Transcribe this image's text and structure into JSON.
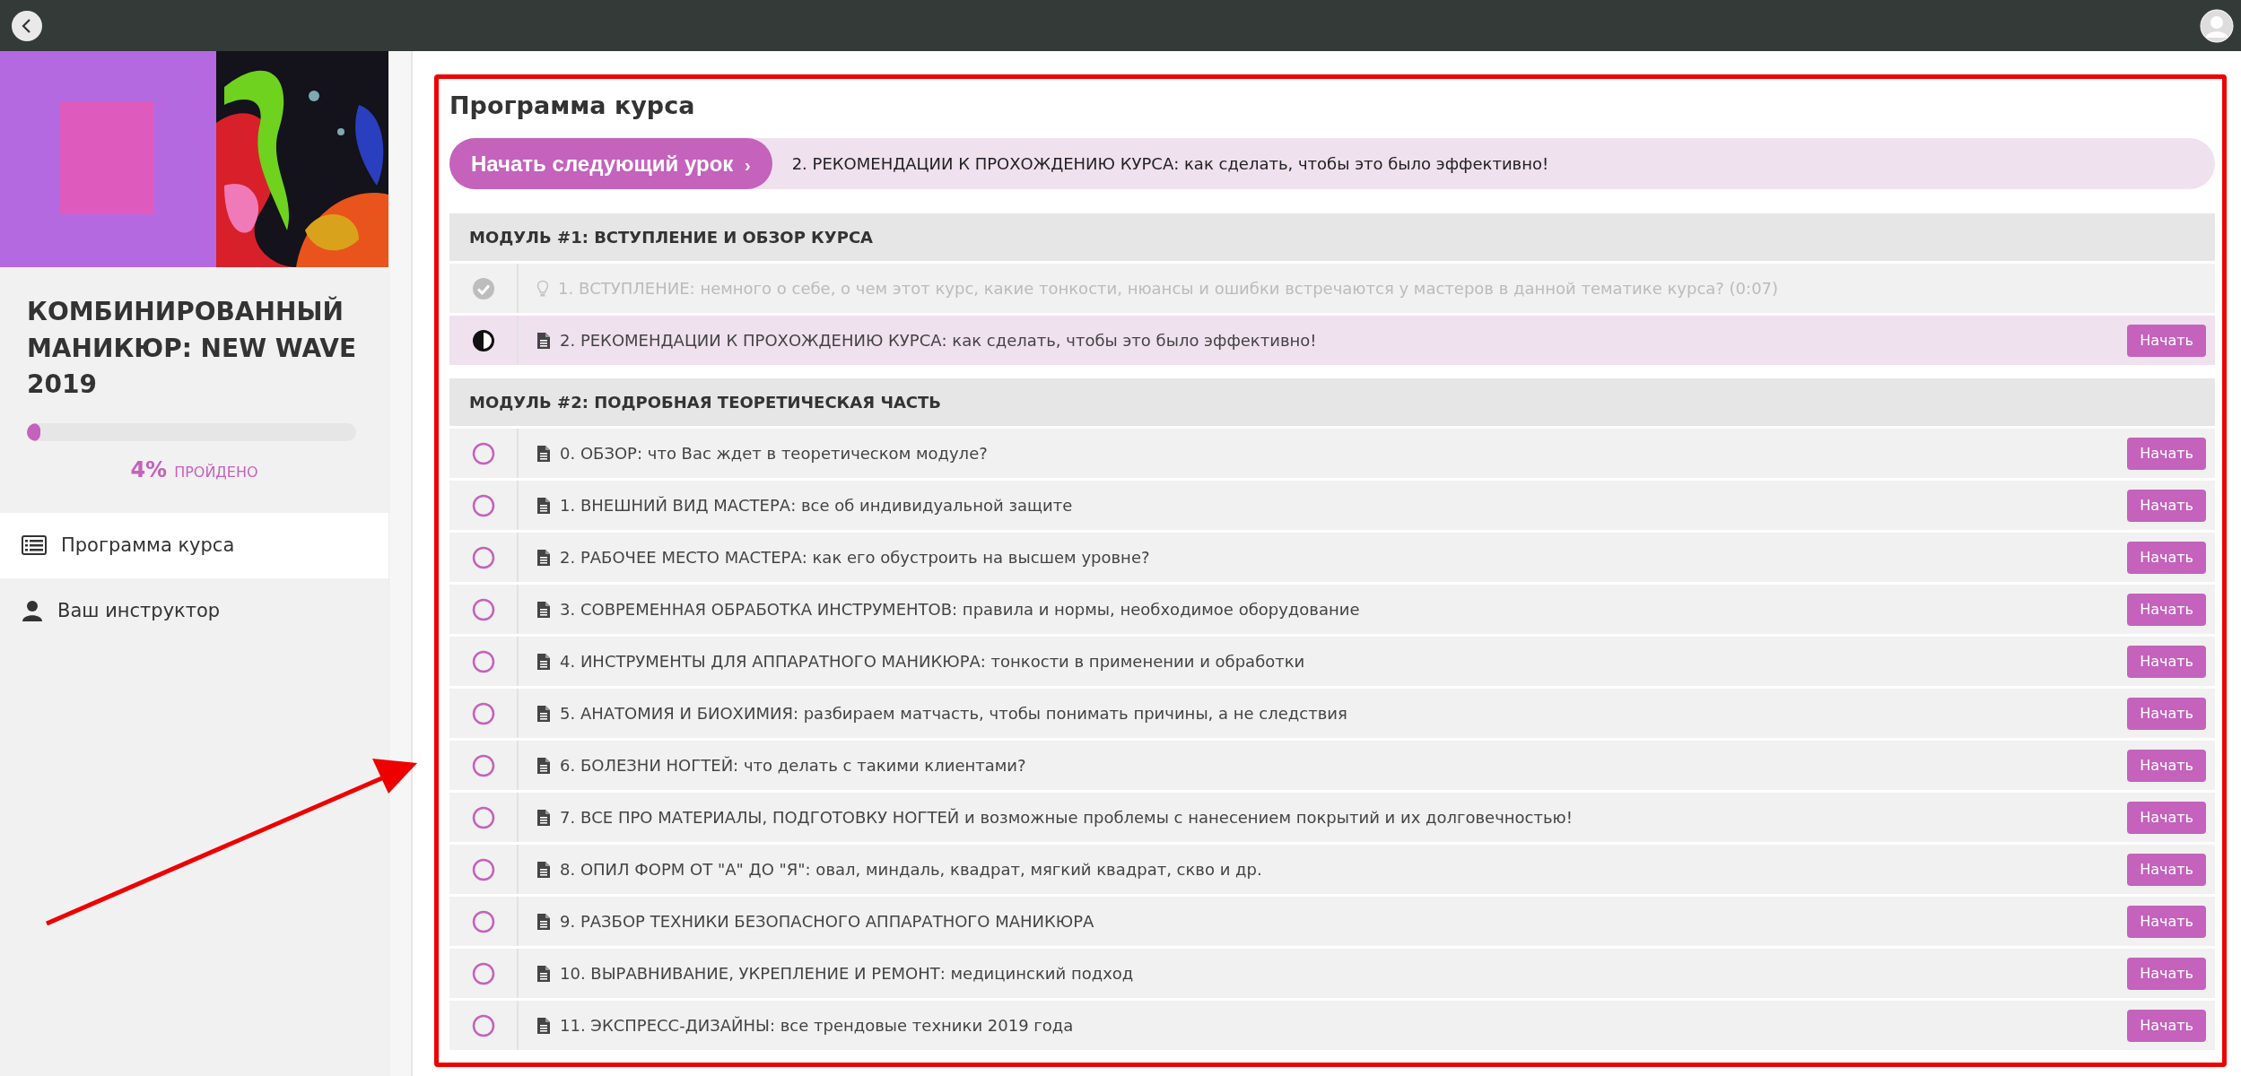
{
  "course": {
    "title": "КОМБИНИРОВАННЫЙ МАНИКЮР: NEW WAVE 2019",
    "progress": {
      "level": 0.04,
      "percent": "4%",
      "label": "ПРОЙДЕНО"
    }
  },
  "sidebar": {
    "items": [
      {
        "label": "Программа курса",
        "kind": "list",
        "selected": true
      },
      {
        "label": "Ваш инструктор",
        "kind": "person",
        "selected": false
      }
    ]
  },
  "main": {
    "title": "Программа курса",
    "next_lesson": {
      "button": "Начать следующий урок",
      "chevron": "›",
      "lesson": "2. РЕКОМЕНДАЦИИ К ПРОХОЖДЕНИЮ КУРСА: как сделать, чтобы это было эффективно!"
    },
    "modules": [
      {
        "title": "МОДУЛЬ #1: ВСТУПЛЕНИЕ И ОБЗОР КУРСА",
        "lessons": [
          {
            "done": true,
            "selected": false,
            "kind": "video",
            "title": "1. ВСТУПЛЕНИЕ: немного о себе, о чем этот курс, какие тонкости, нюансы и ошибки встречаются у мастеров в данной тематике курса? (0:07)"
          },
          {
            "done": false,
            "selected": true,
            "kind": "text",
            "title": "2. РЕКОМЕНДАЦИИ К ПРОХОЖДЕНИЮ КУРСА: как сделать, чтобы это было эффективно!",
            "button": "Начать"
          }
        ]
      },
      {
        "title": "МОДУЛЬ #2: ПОДРОБНАЯ ТЕОРЕТИЧЕСКАЯ ЧАСТЬ",
        "lessons": [
          {
            "done": false,
            "selected": false,
            "kind": "text",
            "title": "0. ОБЗОР: что Вас ждет в теоретическом модуле?",
            "button": "Начать"
          },
          {
            "done": false,
            "selected": false,
            "kind": "text",
            "title": "1. ВНЕШНИЙ ВИД МАСТЕРА: все об индивидуальной защите",
            "button": "Начать"
          },
          {
            "done": false,
            "selected": false,
            "kind": "text",
            "title": "2. РАБОЧЕЕ МЕСТО МАСТЕРА: как его обустроить на высшем уровне?",
            "button": "Начать"
          },
          {
            "done": false,
            "selected": false,
            "kind": "text",
            "title": "3. СОВРЕМЕННАЯ ОБРАБОТКА ИНСТРУМЕНТОВ: правила и нормы, необходимое оборудование",
            "button": "Начать"
          },
          {
            "done": false,
            "selected": false,
            "kind": "text",
            "title": "4. ИНСТРУМЕНТЫ ДЛЯ АППАРАТНОГО МАНИКЮРА: тонкости в применении и обработки",
            "button": "Начать"
          },
          {
            "done": false,
            "selected": false,
            "kind": "text",
            "title": "5. АНАТОМИЯ И БИОХИМИЯ: разбираем матчасть, чтобы понимать причины, а не следствия",
            "button": "Начать"
          },
          {
            "done": false,
            "selected": false,
            "kind": "text",
            "title": "6. БОЛЕЗНИ НОГТЕЙ: что делать с такими клиентами?",
            "button": "Начать"
          },
          {
            "done": false,
            "selected": false,
            "kind": "text",
            "title": "7. ВСЕ ПРО МАТЕРИАЛЫ, ПОДГОТОВКУ НОГТЕЙ и возможные проблемы с нанесением покрытий и их долговечностью!",
            "button": "Начать"
          },
          {
            "done": false,
            "selected": false,
            "kind": "text",
            "title": "8. ОПИЛ ФОРМ ОТ \"А\" ДО \"Я\": овал, миндаль, квадрат, мягкий квадрат, скво и др.",
            "button": "Начать"
          },
          {
            "done": false,
            "selected": false,
            "kind": "text",
            "title": "9. РАЗБОР ТЕХНИКИ БЕЗОПАСНОГО АППАРАТНОГО МАНИКЮРА",
            "button": "Начать"
          },
          {
            "done": false,
            "selected": false,
            "kind": "text",
            "title": "10. ВЫРАВНИВАНИЕ, УКРЕПЛЕНИЕ И РЕМОНТ: медицинский подход",
            "button": "Начать"
          },
          {
            "done": false,
            "selected": false,
            "kind": "text",
            "title": "11. ЭКСПРЕСС-ДИЗАЙНЫ: все трендовые техники 2019 года",
            "button": "Начать"
          }
        ]
      }
    ]
  }
}
